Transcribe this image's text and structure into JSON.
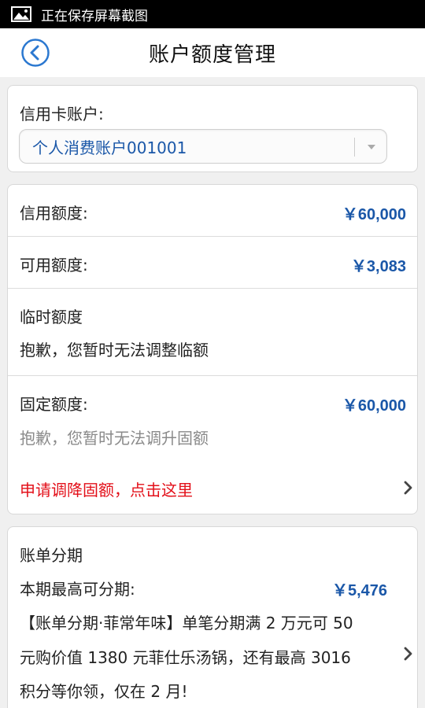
{
  "status_bar": {
    "text": "正在保存屏幕截图",
    "icon": "image-icon"
  },
  "nav": {
    "title": "账户额度管理",
    "back_icon": "back-arrow-icon"
  },
  "account": {
    "label": "信用卡账户:",
    "selected": "个人消费账户001001"
  },
  "limits": {
    "credit_label": "信用额度:",
    "credit_value": "￥60,000",
    "available_label": "可用额度:",
    "available_value": "￥3,083",
    "temp_label": "临时额度",
    "temp_note": "抱歉，您暂时无法调整临额",
    "fixed_label": "固定额度:",
    "fixed_value": "￥60,000",
    "fixed_note": "抱歉，您暂时无法调升固额",
    "lower_link": "申请调降固额，点击这里"
  },
  "installment": {
    "title": "账单分期",
    "max_label": "本期最高可分期:",
    "max_value": "￥5,476",
    "promo_line1": "【账单分期·菲常年味】单笔分期满 2 万元可 50",
    "promo_line2": "元购价值 1380 元菲仕乐汤锅，还有最高 3016",
    "promo_line3": "积分等你领，仅在 2 月!"
  },
  "colors": {
    "accent": "#1a57a8",
    "warning": "#e3101a",
    "background": "#f0f0f0"
  }
}
